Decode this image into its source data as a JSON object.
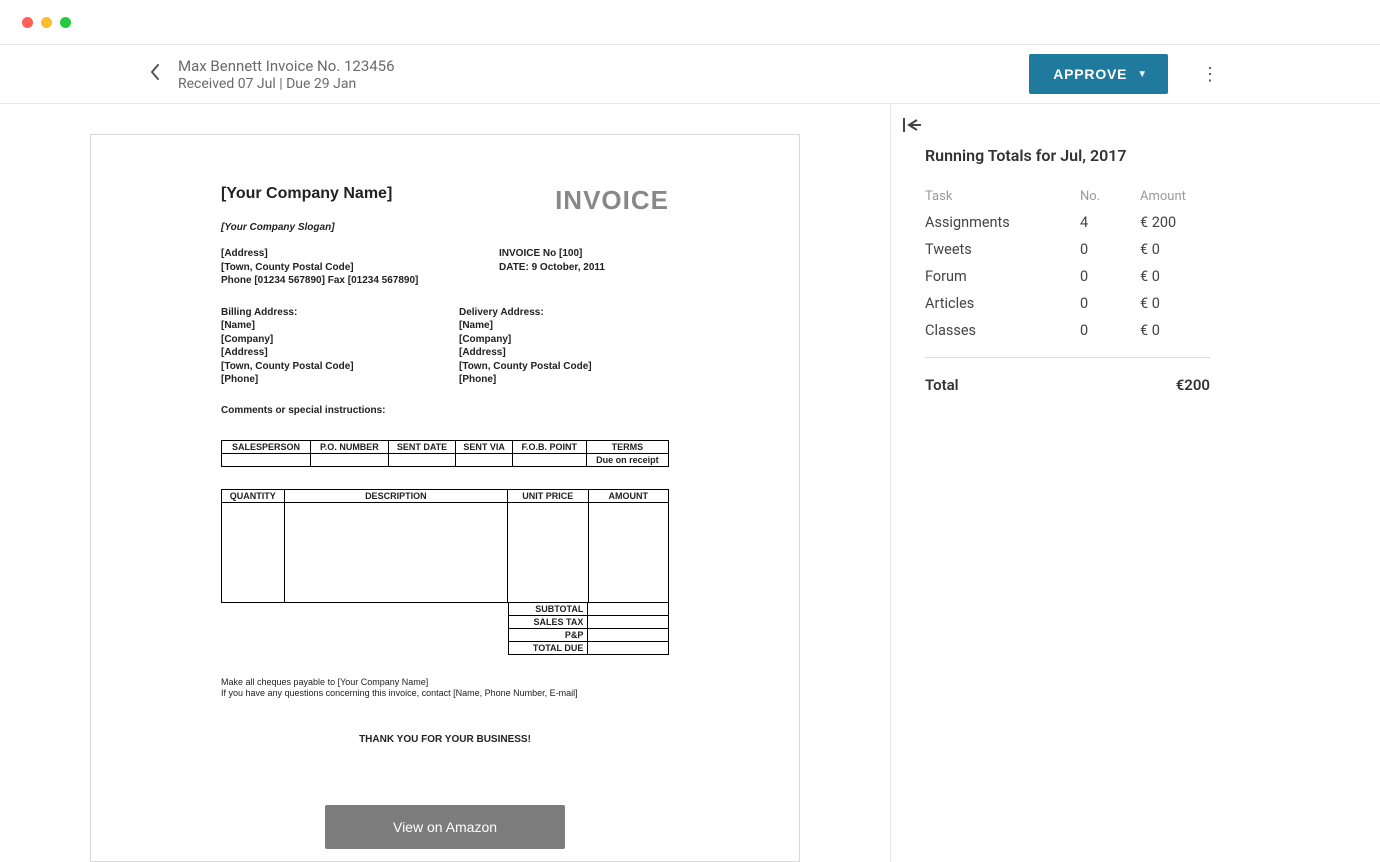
{
  "header": {
    "title": "Max Bennett Invoice No. 123456",
    "subtitle": "Received 07 Jul | Due 29 Jan",
    "approve_label": "APPROVE"
  },
  "sidebar": {
    "title": "Running Totals for Jul, 2017",
    "columns": {
      "task": "Task",
      "no": "No.",
      "amount": "Amount"
    },
    "rows": [
      {
        "task": "Assignments",
        "no": "4",
        "amount": "€ 200"
      },
      {
        "task": "Tweets",
        "no": "0",
        "amount": "€ 0"
      },
      {
        "task": "Forum",
        "no": "0",
        "amount": "€ 0"
      },
      {
        "task": "Articles",
        "no": "0",
        "amount": "€ 0"
      },
      {
        "task": "Classes",
        "no": "0",
        "amount": "€ 0"
      }
    ],
    "total_label": "Total",
    "total_amount": "€200"
  },
  "document": {
    "company": "[Your Company Name]",
    "slogan": "[Your Company Slogan]",
    "invoice_word": "INVOICE",
    "meta_left": [
      "[Address]",
      "[Town, County  Postal Code]",
      "Phone [01234 567890] Fax [01234 567890]"
    ],
    "meta_right": [
      "INVOICE No [100]",
      "DATE:  9 October, 2011"
    ],
    "billing_heading": "Billing Address:",
    "delivery_heading": "Delivery Address:",
    "addr_fields": [
      "[Name]",
      "[Company]",
      "[Address]",
      "[Town, County  Postal Code]",
      "[Phone]"
    ],
    "comments_label": "Comments or special instructions:",
    "ship_headers": [
      "SALESPERSON",
      "P.O. NUMBER",
      "SENT DATE",
      "SENT VIA",
      "F.O.B. POINT",
      "TERMS"
    ],
    "ship_values": [
      "",
      "",
      "",
      "",
      "",
      "Due on receipt"
    ],
    "item_headers": [
      "QUANTITY",
      "DESCRIPTION",
      "UNIT PRICE",
      "AMOUNT"
    ],
    "subtotals": [
      "SUBTOTAL",
      "SALES TAX",
      "P&P",
      "TOTAL DUE"
    ],
    "footer_line1": "Make all cheques payable to [Your Company Name]",
    "footer_line2": "If you have any questions concerning this invoice, contact [Name, Phone Number, E-mail]",
    "thanks": "THANK YOU FOR YOUR BUSINESS!"
  },
  "amazon_btn": "View on Amazon"
}
